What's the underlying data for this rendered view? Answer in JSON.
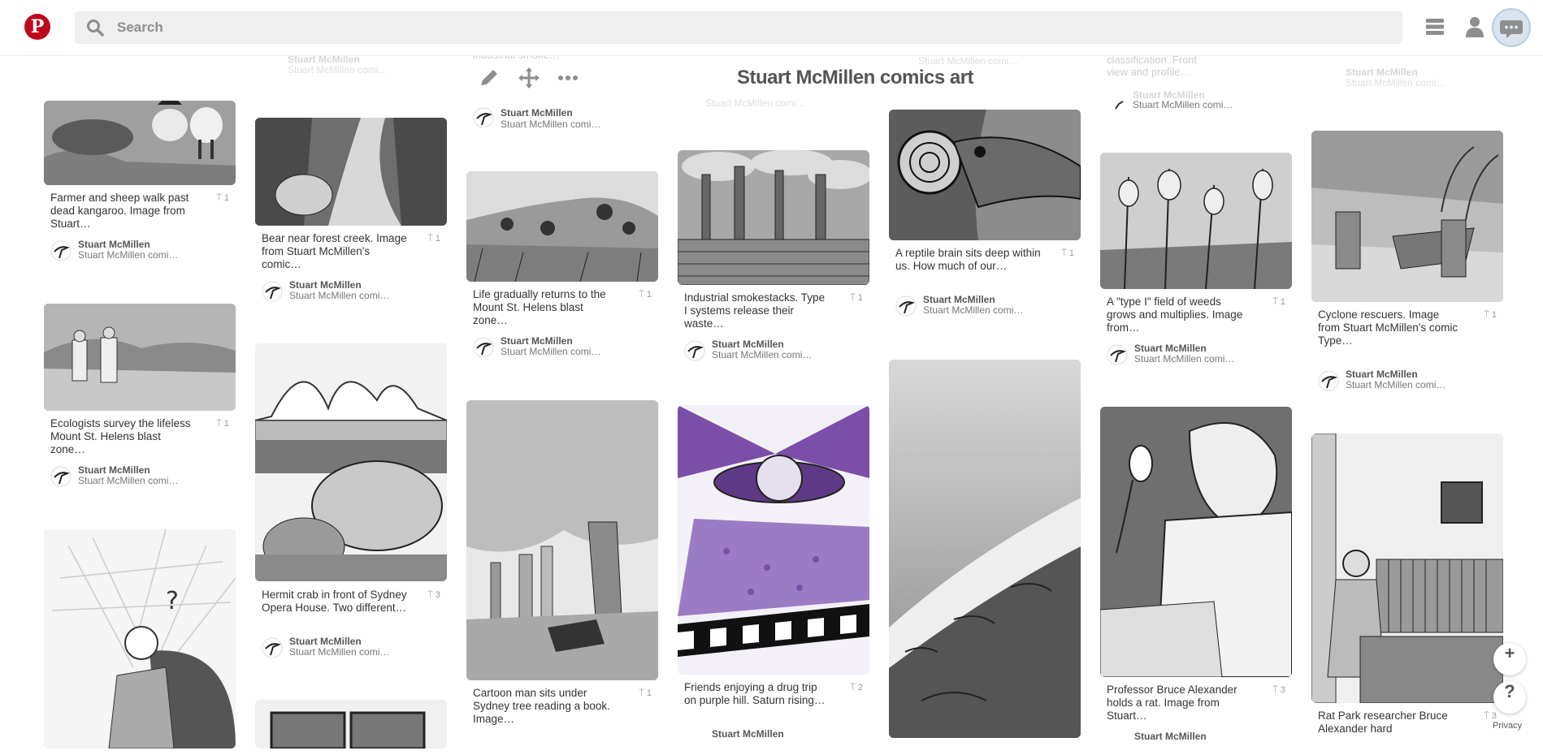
{
  "header": {
    "search_placeholder": "Search"
  },
  "board": {
    "title": "Stuart McMillen comics art"
  },
  "pins": [
    {
      "desc": "Farmer and sheep walk past dead kangaroo. Image from Stuart…",
      "repins": "1",
      "user": "Stuart McMillen",
      "board": "Stuart McMillen comi…"
    },
    {
      "desc": "Ecologists survey the lifeless Mount St. Helens blast zone…",
      "repins": "1",
      "user": "Stuart McMillen",
      "board": "Stuart McMillen comi…"
    },
    {
      "desc": "Bear near forest creek. Image from Stuart McMillen's comic…",
      "repins": "1",
      "user": "Stuart McMillen",
      "board": "Stuart McMillen comi…"
    },
    {
      "desc": "Hermit crab in front of Sydney Opera House. Two different…",
      "repins": "3",
      "user": "Stuart McMillen",
      "board": "Stuart McMillen comi…"
    },
    {
      "desc": "Life gradually returns to the Mount St. Helens blast zone…",
      "repins": "1",
      "user": "Stuart McMillen",
      "board": "Stuart McMillen comi…"
    },
    {
      "desc": "Cartoon man sits under Sydney tree reading a book. Image…",
      "repins": "1",
      "user": "Stuart McMillen",
      "board": "Stuart McMillen comi…"
    },
    {
      "desc": "Industrial smokestacks. Type I systems release their waste…",
      "repins": "1",
      "user": "Stuart McMillen",
      "board": "Stuart McMillen comi…"
    },
    {
      "desc": "Friends enjoying a drug trip on purple hill. Saturn rising…",
      "repins": "2",
      "user": "Stuart McMillen",
      "board": ""
    },
    {
      "desc": "A reptile brain sits deep within us. How much of our…",
      "repins": "1",
      "user": "Stuart McMillen",
      "board": "Stuart McMillen comi…"
    },
    {
      "desc": "A \"type I\" field of weeds grows and multiplies. Image from…",
      "repins": "1",
      "user": "Stuart McMillen",
      "board": "Stuart McMillen comi…"
    },
    {
      "desc": "Professor Bruce Alexander holds a rat. Image from Stuart…",
      "repins": "3",
      "user": "Stuart McMillen",
      "board": ""
    },
    {
      "desc": "Cyclone rescuers. Image from Stuart McMillen's comic Type…",
      "repins": "1",
      "user": "Stuart McMillen",
      "board": "Stuart McMillen comi…"
    },
    {
      "desc": "Rat Park researcher Bruce Alexander hard",
      "repins": "3",
      "user": "",
      "board": ""
    }
  ],
  "faded_top": {
    "col2_user": "Stuart McMillen",
    "col2_board": "Stuart McMillen comi…",
    "col3_desc": "industrial smoke…",
    "col3_user": "Stuart McMillen",
    "col3_board": "Stuart McMillen comi…",
    "col4_user": "Stuart McMillen comi…",
    "col5_text": "Stuart McMillen comi…",
    "col6_desc": "classification. Front view and profile…",
    "col6_user": "Stuart McMillen",
    "col6_board": "Stuart McMillen comi…",
    "col7_user": "Stuart McMillen",
    "col7_board": "Stuart McMillen comi…"
  },
  "floating": {
    "add": "+",
    "help": "?",
    "privacy": "Privacy"
  },
  "colors": {
    "brand": "#bd081c",
    "purple": "#7b4fa8"
  },
  "icons": [
    "pinterest-logo-icon",
    "search-icon",
    "menu-icon",
    "profile-icon",
    "chat-icon",
    "edit-icon",
    "move-icon",
    "more-icon",
    "pin-icon"
  ]
}
